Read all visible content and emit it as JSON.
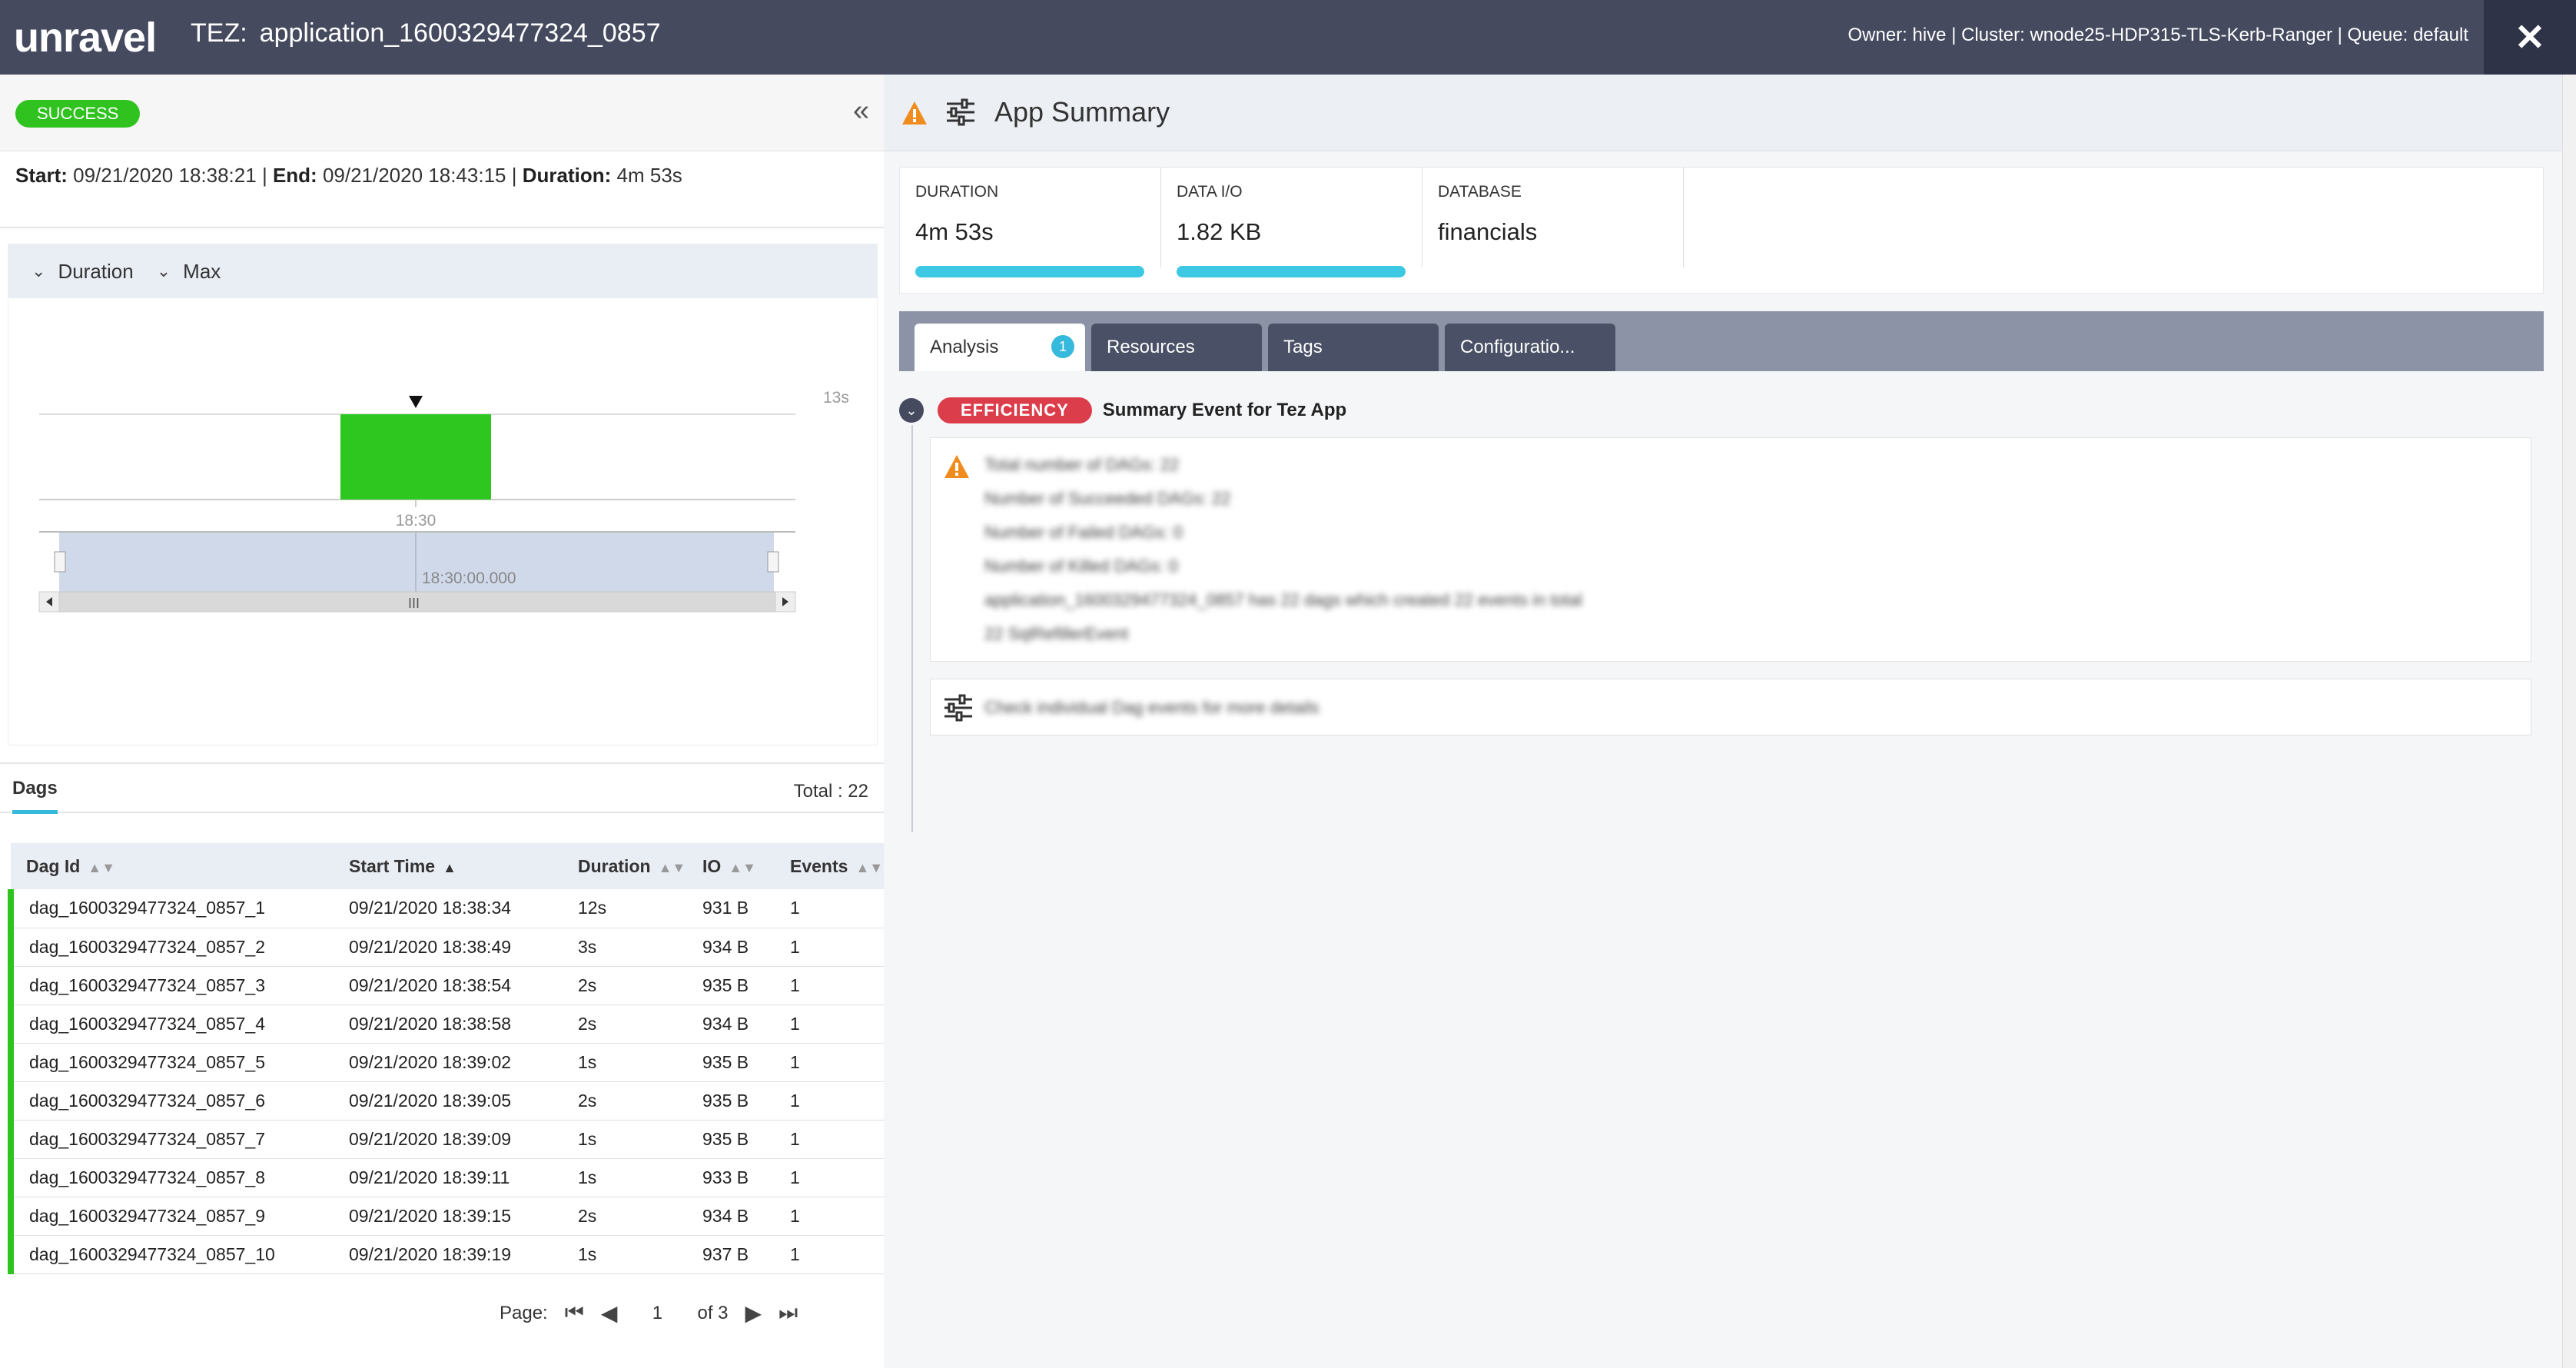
{
  "header": {
    "logo": "unravel",
    "app_kind": "TEZ:",
    "app_id": "application_1600329477324_0857",
    "owner_line": "Owner: hive | Cluster: wnode25-HDP315-TLS-Kerb-Ranger | Queue: default",
    "close_icon": "close-icon"
  },
  "left": {
    "status": "SUCCESS",
    "collapse_icon": "double-chevron-left-icon",
    "timing": {
      "start_label": "Start:",
      "start_value": "09/21/2020 18:38:21",
      "end_label": "End:",
      "end_value": "09/21/2020 18:43:15",
      "duration_label": "Duration:",
      "duration_value": "4m 53s",
      "separator": "|"
    },
    "chart_controls": {
      "metric": "Duration",
      "aggregate": "Max"
    }
  },
  "chart_data": {
    "type": "bar",
    "categories": [
      "18:30"
    ],
    "values": [
      13
    ],
    "y_tick_label": "13s",
    "ylim": [
      0,
      13
    ],
    "bar_color": "#2dc71f",
    "navigator_label": "18:30:00.000",
    "title": "",
    "xlabel": "",
    "ylabel": ""
  },
  "dags": {
    "tab_label": "Dags",
    "total_label": "Total : 22",
    "columns": [
      "Dag Id",
      "Start Time",
      "Duration",
      "IO",
      "Events"
    ],
    "rows": [
      [
        "dag_1600329477324_0857_1",
        "09/21/2020 18:38:34",
        "12s",
        "931 B",
        "1"
      ],
      [
        "dag_1600329477324_0857_2",
        "09/21/2020 18:38:49",
        "3s",
        "934 B",
        "1"
      ],
      [
        "dag_1600329477324_0857_3",
        "09/21/2020 18:38:54",
        "2s",
        "935 B",
        "1"
      ],
      [
        "dag_1600329477324_0857_4",
        "09/21/2020 18:38:58",
        "2s",
        "934 B",
        "1"
      ],
      [
        "dag_1600329477324_0857_5",
        "09/21/2020 18:39:02",
        "1s",
        "935 B",
        "1"
      ],
      [
        "dag_1600329477324_0857_6",
        "09/21/2020 18:39:05",
        "2s",
        "935 B",
        "1"
      ],
      [
        "dag_1600329477324_0857_7",
        "09/21/2020 18:39:09",
        "1s",
        "935 B",
        "1"
      ],
      [
        "dag_1600329477324_0857_8",
        "09/21/2020 18:39:11",
        "1s",
        "933 B",
        "1"
      ],
      [
        "dag_1600329477324_0857_9",
        "09/21/2020 18:39:15",
        "2s",
        "934 B",
        "1"
      ],
      [
        "dag_1600329477324_0857_10",
        "09/21/2020 18:39:19",
        "1s",
        "937 B",
        "1"
      ]
    ],
    "pager": {
      "label": "Page:",
      "current": "1",
      "of_label": "of 3"
    }
  },
  "right": {
    "summary_title": "App Summary",
    "metrics": [
      {
        "label": "DURATION",
        "value": "4m 53s",
        "bar_fraction": 1.0
      },
      {
        "label": "DATA I/O",
        "value": "1.82 KB",
        "bar_fraction": 1.0
      },
      {
        "label": "DATABASE",
        "value": "financials"
      }
    ],
    "tabs": [
      {
        "label": "Analysis",
        "count": "1"
      },
      {
        "label": "Resources"
      },
      {
        "label": "Tags"
      },
      {
        "label": "Configuratio..."
      }
    ],
    "event": {
      "badge": "EFFICIENCY",
      "title": "Summary Event for Tez App",
      "lines": [
        "Total number of DAGs: 22",
        "Number of Succeeded DAGs: 22",
        "Number of Failed DAGs: 0",
        "Number of Killed DAGs: 0",
        "application_1600329477324_0857 has 22 dags which created 22 events in total",
        "22 SqlRefillerEvent"
      ],
      "second": "Check individual Dag events for more details"
    }
  },
  "colors": {
    "header_bg": "#454a5f",
    "success": "#30c21f",
    "accent": "#35b9dc",
    "efficiency": "#dc3d4b",
    "warning": "#f08c1e"
  }
}
